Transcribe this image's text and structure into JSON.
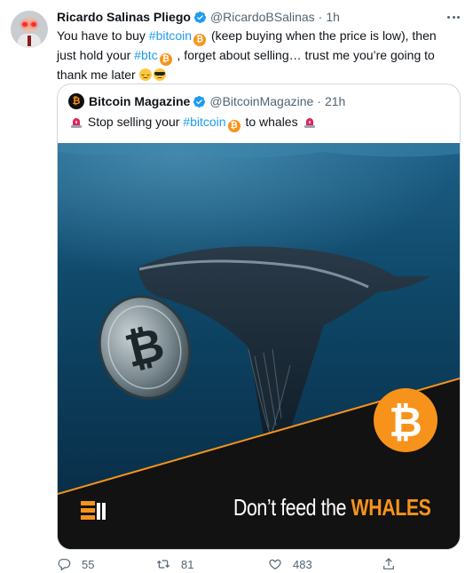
{
  "tweet": {
    "author_name": "Ricardo Salinas Pliego",
    "author_handle": "@RicardoBSalinas",
    "separator": "·",
    "time": "1h",
    "text_parts": {
      "p1": "You have to buy ",
      "tag1": "#bitcoin",
      "p2": " (keep buying when the price is low), then just hold your ",
      "tag2": "#btc",
      "p3": " , forget about selling… trust me you’re going to thank me later "
    }
  },
  "quoted": {
    "author_name": "Bitcoin Magazine",
    "author_handle": "@BitcoinMagazine",
    "separator": "·",
    "time": "21h",
    "text_parts": {
      "p1": " Stop selling your ",
      "tag1": "#bitcoin",
      "p2": " to whales "
    },
    "image": {
      "tagline_prefix": "Don’t feed the ",
      "tagline_emphasis": "WHALES",
      "coin_symbol": "₿"
    }
  },
  "actions": {
    "replies": "55",
    "retweets": "81",
    "likes": "483"
  },
  "icons": {
    "verified": "verified-badge-icon",
    "more": "more-options-icon",
    "reply": "reply-icon",
    "retweet": "retweet-icon",
    "like": "heart-icon",
    "share": "share-icon",
    "bitcoin": "bitcoin-icon",
    "siren": "police-light-icon",
    "relieved": "relieved-face-icon",
    "cool": "sunglasses-face-icon"
  },
  "colors": {
    "accent": "#1d9bf0",
    "bitcoin_orange": "#f7931a",
    "text_secondary": "#536471"
  }
}
